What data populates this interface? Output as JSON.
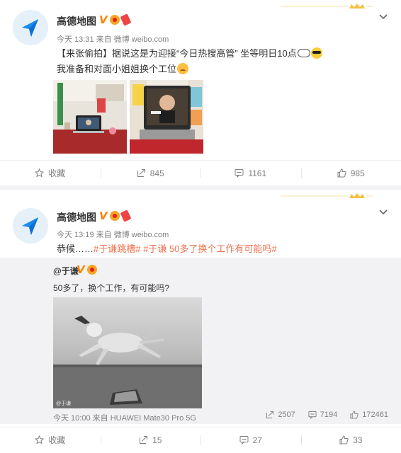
{
  "post1": {
    "username": "高德地图",
    "verified_badge": "V",
    "meta": "今天 13:31 来自 微博 weibo.com",
    "line1": "【来张偷拍】据说这是为迎接“今日热搜高管” 坐等明日10点",
    "line2": "我准备和对面小姐姐换个工位",
    "actions": {
      "favorite_label": "收藏",
      "repost_count": "845",
      "comment_count": "1161",
      "like_count": "985"
    },
    "icons": [
      "star-icon",
      "repost-icon",
      "comment-icon",
      "like-icon",
      "chevron-down-icon"
    ]
  },
  "post2": {
    "username": "高德地图",
    "verified_badge": "V",
    "meta": "今天 13:19 来自 微博 weibo.com",
    "text_prefix": "恭候……",
    "hashtag1": "#于谦跳槽#",
    "hashtag2": "#于谦 50多了换个工作有可能吗#",
    "repost": {
      "author": "@于谦",
      "verified_badge": "V",
      "text": "50多了，换个工作，有可能吗?",
      "meta": "今天 10:00 来自 HUAWEI Mate30 Pro 5G",
      "repost_count": "2507",
      "comment_count": "7194",
      "like_count": "172461"
    },
    "actions": {
      "favorite_label": "收藏",
      "repost_count": "15",
      "comment_count": "27",
      "like_count": "33"
    }
  },
  "colors": {
    "accent": "#ff8200",
    "hashtag": "#eb7350",
    "meta": "#808080",
    "background": "#f2f2f5"
  }
}
